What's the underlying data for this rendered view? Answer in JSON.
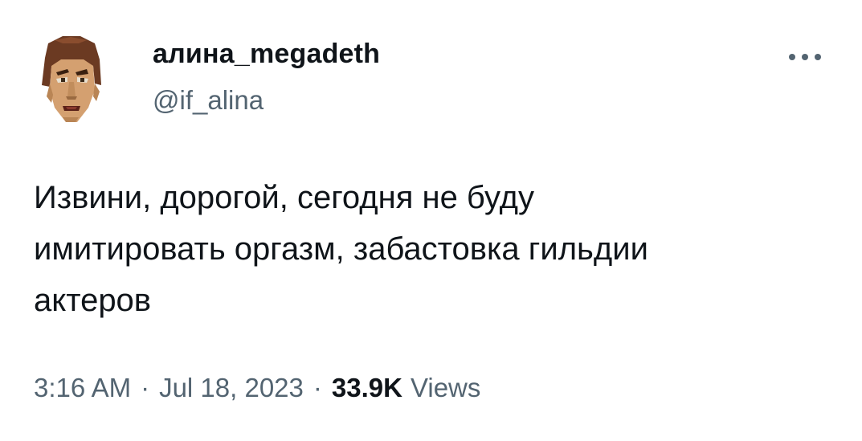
{
  "tweet": {
    "display_name": "алина_megadeth",
    "handle": "@if_alina",
    "text": "Извини, дорогой, сегодня не буду\nимитировать оргазм, забастовка гильдии\nактеров",
    "time": "3:16 AM",
    "separator": "·",
    "date": "Jul 18, 2023",
    "views_count": "33.9K",
    "views_label": "Views",
    "more_icon": "more-horizontal-icon"
  },
  "colors": {
    "text_primary": "#0f1419",
    "text_secondary": "#536471",
    "background": "#ffffff"
  }
}
